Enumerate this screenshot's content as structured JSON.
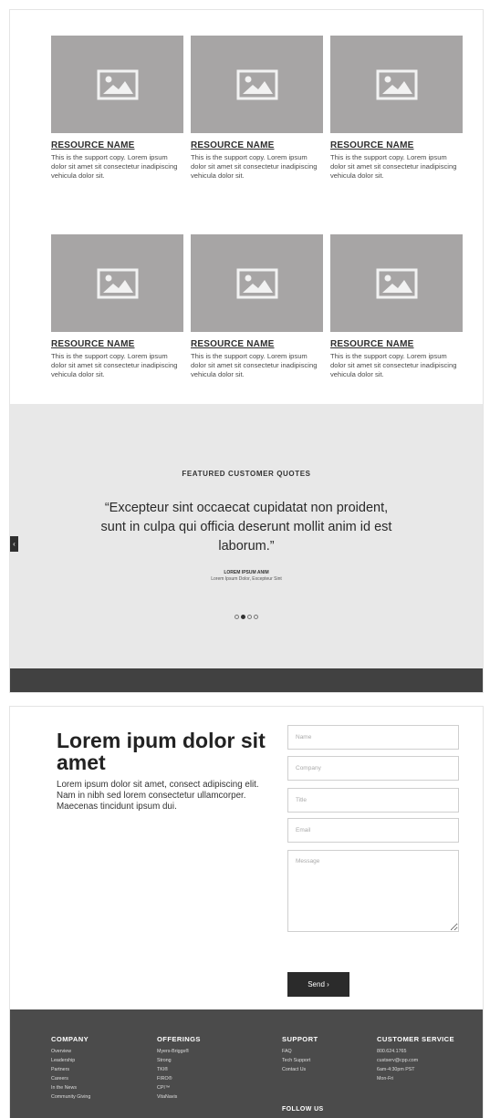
{
  "resources": {
    "row1": [
      {
        "name": "RESOURCE NAME",
        "copy": "This is the support copy. Lorem ipsum dolor sit amet sit consectetur inadipiscing vehicula dolor sit."
      },
      {
        "name": "RESOURCE NAME",
        "copy": "This is the support copy. Lorem ipsum dolor sit amet sit consectetur inadipiscing vehicula dolor sit."
      },
      {
        "name": "RESOURCE NAME",
        "copy": "This is the support copy. Lorem ipsum dolor sit amet sit consectetur inadipiscing vehicula dolor sit."
      }
    ],
    "row2": [
      {
        "name": "RESOURCE NAME",
        "copy": "This is the support copy. Lorem ipsum dolor sit amet sit consectetur inadipiscing vehicula dolor sit."
      },
      {
        "name": "RESOURCE NAME",
        "copy": "This is the support copy. Lorem ipsum dolor sit amet sit consectetur inadipiscing vehicula dolor sit."
      },
      {
        "name": "RESOURCE NAME",
        "copy": "This is the support copy. Lorem ipsum dolor sit amet sit consectetur inadipiscing vehicula dolor sit."
      }
    ]
  },
  "quotes": {
    "heading": "FEATURED CUSTOMER QUOTES",
    "text": "“Excepteur sint occaecat cupidatat non proident, sunt in culpa qui officia deserunt mollit anim id est laborum.”",
    "author": "LOREM IPSUM ANIM",
    "role": "Lorem Ipsum Dolor, Excepteur Sint",
    "prev_icon": "‹",
    "dots_total": 4,
    "active_dot": 2
  },
  "contact": {
    "headline": "Lorem ipum dolor sit amet",
    "body": "Lorem ipsum dolor sit amet, consect adipiscing elit. Nam in nibh sed lorem consectetur ullamcorper. Maecenas tincidunt ipsum dui.",
    "placeholders": {
      "name": "Name",
      "company": "Company",
      "title": "Title",
      "email": "Email",
      "message": "Message"
    },
    "send_label": "Send  ›"
  },
  "footer": {
    "company": {
      "heading": "COMPANY",
      "links": [
        "Overview",
        "Leadership",
        "Partners",
        "Careers",
        "In the News",
        "Community Giving"
      ]
    },
    "offerings": {
      "heading": "OFFERINGS",
      "links": [
        "Myers-Briggs®",
        "Strong",
        "TKI®",
        "FIRO®",
        "CPI™",
        "VitaNavis"
      ]
    },
    "support": {
      "heading": "SUPPORT",
      "links": [
        "FAQ",
        "Tech Support",
        "Contact Us"
      ]
    },
    "follow_heading": "FOLLOW US",
    "customer_service": {
      "heading": "CUSTOMER SERVICE",
      "links": [
        "800.624.1765",
        "custserv@cpp.com",
        "6am-4:30pm PST",
        "Mon-Fri"
      ]
    }
  },
  "colors": {
    "thumb": "#a7a5a5",
    "quote_bg": "#e8e8e8",
    "dark_bar": "#414141",
    "footer_bg": "#4b4b4b",
    "button": "#2b2b2b"
  }
}
